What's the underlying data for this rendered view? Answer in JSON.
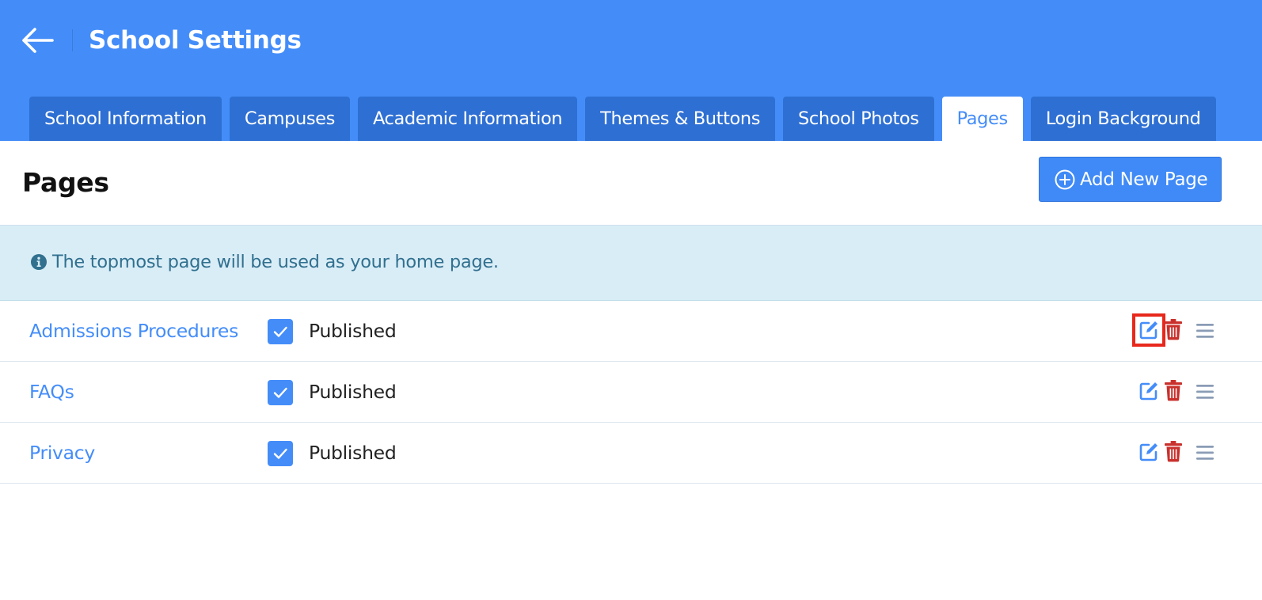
{
  "header": {
    "title": "School Settings",
    "background_color": "#448df9",
    "back_icon": "arrow-left-icon"
  },
  "tabs": [
    {
      "label": "School Information",
      "active": false
    },
    {
      "label": "Campuses",
      "active": false
    },
    {
      "label": "Academic Information",
      "active": false
    },
    {
      "label": "Themes & Buttons",
      "active": false
    },
    {
      "label": "School Photos",
      "active": false
    },
    {
      "label": "Pages",
      "active": true
    },
    {
      "label": "Login Background",
      "active": false
    }
  ],
  "main": {
    "title": "Pages",
    "add_button": {
      "label": "Add New Page",
      "icon": "plus-circle-icon",
      "color": "#3f8af7"
    },
    "info": {
      "text": "The topmost page will be used as your home page.",
      "icon": "info-circle-icon",
      "background": "#d9edf7",
      "text_color": "#31708f"
    },
    "pages": [
      {
        "name": "Admissions Procedures",
        "status": "Published",
        "published": true,
        "highlighted": true
      },
      {
        "name": "FAQs",
        "status": "Published",
        "published": true,
        "highlighted": false
      },
      {
        "name": "Privacy",
        "status": "Published",
        "published": true,
        "highlighted": false
      }
    ]
  },
  "colors": {
    "accent": "#448df9",
    "tab_inactive": "#2e6fd3",
    "delete": "#c9302c",
    "handle": "#8a9cb5",
    "highlight_border": "#e8281c"
  }
}
